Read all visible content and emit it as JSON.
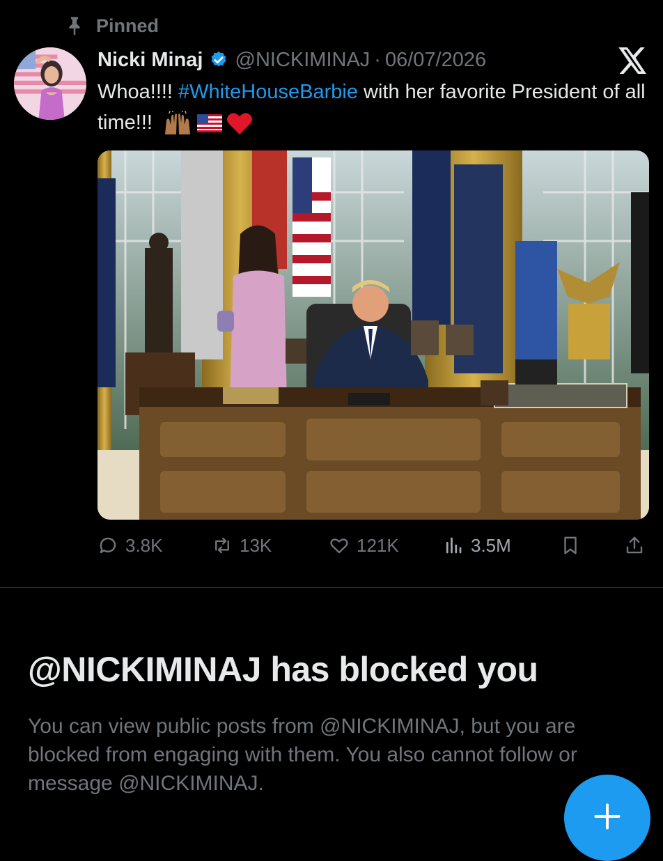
{
  "pinned": {
    "label": "Pinned",
    "icon": "pin-icon"
  },
  "tweet": {
    "display_name": "Nicki Minaj",
    "verified_icon": "verified-badge-icon",
    "handle": "@NICKIMINAJ",
    "separator": "·",
    "date": "06/07/2026",
    "text_before": "Whoa!!!! ",
    "hashtag": "#WhiteHouseBarbie",
    "text_after": " with her favorite President of all time!!! ",
    "emojis": [
      "raising-hands-emoji",
      "us-flag-emoji",
      "red-heart-emoji"
    ],
    "media_icon": "photo-oval-office"
  },
  "actions": {
    "replies": "3.8K",
    "reposts": "13K",
    "likes": "121K",
    "views": "3.5M",
    "icons": [
      "reply-icon",
      "repost-icon",
      "like-icon",
      "views-icon",
      "bookmark-icon",
      "share-icon"
    ]
  },
  "blocked": {
    "title": "@NICKIMINAJ has blocked you",
    "body": "You can view public posts from @NICKIMINAJ, but you are blocked from engaging with them. You also cannot follow or message @NICKIMINAJ."
  },
  "colors": {
    "background": "#000000",
    "accent": "#1d9bf0",
    "secondary_text": "#71767b",
    "primary_text": "#e7e9ea"
  }
}
